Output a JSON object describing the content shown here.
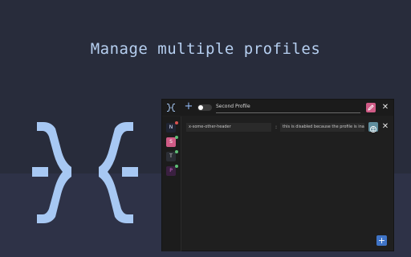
{
  "headline": "Manage multiple profiles",
  "colors": {
    "accent": "#3f74c7",
    "edit": "#d05b86",
    "logo": "#a7c8f3",
    "enabled_dot": "#5fbf76"
  },
  "topbar": {
    "add_label": "+",
    "profile_name": "Second Profile",
    "close_label": "✕",
    "enabled": false
  },
  "profiles": [
    {
      "letter": "N",
      "bg": "#1f2433",
      "color": "#dfe6ff",
      "active": false,
      "dot": "#d9534f"
    },
    {
      "letter": "S",
      "bg": "#d05b86",
      "color": "#ffffff",
      "active": true,
      "dot": "#5fbf76"
    },
    {
      "letter": "T",
      "bg": "#2b2e35",
      "color": "#dcdcdc",
      "active": false,
      "dot": "#5fbf76"
    },
    {
      "letter": "P",
      "bg": "#3a2040",
      "color": "#d66cd6",
      "active": false,
      "dot": "#5fbf76"
    }
  ],
  "header_row": {
    "name": "x-some-other-header",
    "colon": ":",
    "value": "this is disabled because the profile is inactive",
    "close_label": "✕"
  },
  "add_row_label": "+"
}
